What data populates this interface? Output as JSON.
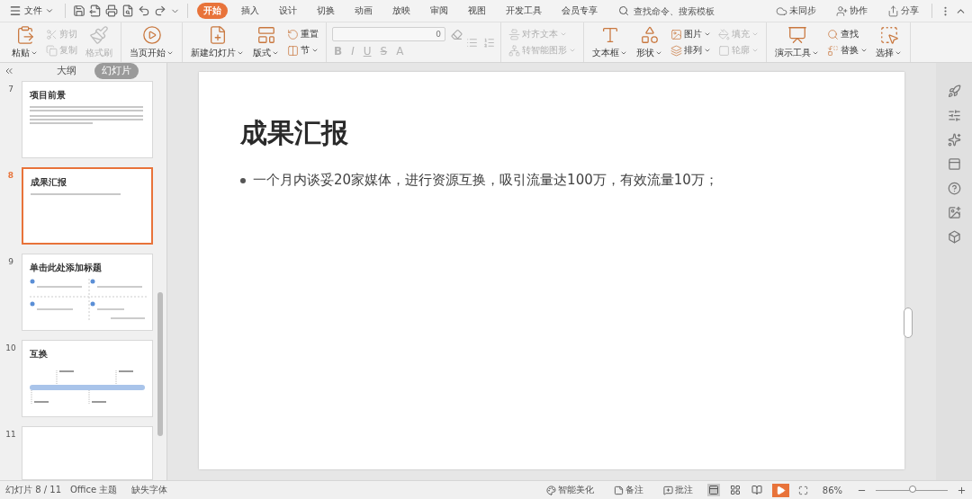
{
  "menu": {
    "label": "文件"
  },
  "tabs": [
    {
      "label": "开始",
      "selected": true
    },
    {
      "label": "插入",
      "selected": false
    },
    {
      "label": "设计",
      "selected": false
    },
    {
      "label": "切换",
      "selected": false
    },
    {
      "label": "动画",
      "selected": false
    },
    {
      "label": "放映",
      "selected": false
    },
    {
      "label": "审阅",
      "selected": false
    },
    {
      "label": "视图",
      "selected": false
    },
    {
      "label": "开发工具",
      "selected": false
    },
    {
      "label": "会员专享",
      "selected": false
    }
  ],
  "search": {
    "placeholder": "查找命令、搜索模板"
  },
  "top_actions": [
    {
      "label": "未同步"
    },
    {
      "label": "协作"
    },
    {
      "label": "分享"
    }
  ],
  "ribbon": [
    {
      "kind": "buttons",
      "items": [
        {
          "label": "粘贴",
          "kind": "large",
          "disabled": false
        },
        {
          "label": "剪切",
          "kind": "small",
          "disabled": true
        },
        {
          "label": "复制",
          "kind": "small",
          "disabled": true
        },
        {
          "label": "格式刷",
          "kind": "large",
          "disabled": true
        }
      ]
    },
    {
      "kind": "buttons",
      "items": [
        {
          "label": "当页开始",
          "kind": "large",
          "disabled": false
        }
      ]
    },
    {
      "kind": "buttons",
      "items": [
        {
          "label": "新建幻灯片",
          "kind": "large",
          "disabled": false
        },
        {
          "label": "版式",
          "kind": "large",
          "disabled": false
        },
        {
          "label": "重置",
          "kind": "small",
          "disabled": false
        },
        {
          "label": "节",
          "kind": "small",
          "disabled": false
        }
      ]
    },
    {
      "kind": "font",
      "size_value": "0",
      "styles": [
        {
          "label": "B",
          "disabled": true
        },
        {
          "label": "I",
          "disabled": true
        },
        {
          "label": "U",
          "disabled": true
        },
        {
          "label": "S",
          "disabled": true
        },
        {
          "label": "A",
          "disabled": true
        }
      ]
    },
    {
      "kind": "buttons",
      "items": [
        {
          "label": "对齐文本",
          "kind": "small",
          "disabled": true
        },
        {
          "label": "转智能图形",
          "kind": "small",
          "disabled": true
        }
      ]
    },
    {
      "kind": "buttons",
      "items": [
        {
          "label": "文本框",
          "kind": "large",
          "disabled": false
        },
        {
          "label": "形状",
          "kind": "large",
          "disabled": false
        },
        {
          "label": "图片",
          "kind": "small",
          "disabled": false
        },
        {
          "label": "排列",
          "kind": "small",
          "disabled": false
        },
        {
          "label": "填充",
          "kind": "small",
          "disabled": true
        },
        {
          "label": "轮廓",
          "kind": "small",
          "disabled": true
        }
      ]
    },
    {
      "kind": "buttons",
      "items": [
        {
          "label": "演示工具",
          "kind": "large",
          "disabled": false
        },
        {
          "label": "查找",
          "kind": "small",
          "disabled": false
        },
        {
          "label": "替换",
          "kind": "small",
          "disabled": false
        },
        {
          "label": "选择",
          "kind": "large",
          "disabled": false
        }
      ]
    }
  ],
  "panel_tabs": [
    {
      "label": "大纲",
      "selected": false
    },
    {
      "label": "幻灯片",
      "selected": true
    }
  ],
  "thumbnails": [
    {
      "number": "7",
      "title": "项目前景",
      "kind": "text",
      "selected": false
    },
    {
      "number": "8",
      "title": "成果汇报",
      "kind": "bullet",
      "selected": true
    },
    {
      "number": "9",
      "title": "单击此处添加标题",
      "kind": "grid",
      "selected": false
    },
    {
      "number": "10",
      "title": "互换",
      "kind": "timeline",
      "selected": false
    },
    {
      "number": "11",
      "kind": "blank",
      "selected": false
    }
  ],
  "slide": {
    "title": "成果汇报",
    "bullets": [
      "一个月内谈妥20家媒体，进行资源互换，吸引流量达100万，有效流量10万；"
    ]
  },
  "status_bar": {
    "slide_count": "幻灯片 8 / 11",
    "theme": "Office 主题",
    "missing_fonts": "缺失字体",
    "beautify": "智能美化",
    "notes": "备注",
    "comments": "批注",
    "views": [
      {
        "selected": true
      },
      {
        "selected": false
      },
      {
        "selected": false
      }
    ],
    "zoom": "86%",
    "zoom_slider": {
      "level": 0.52
    }
  }
}
